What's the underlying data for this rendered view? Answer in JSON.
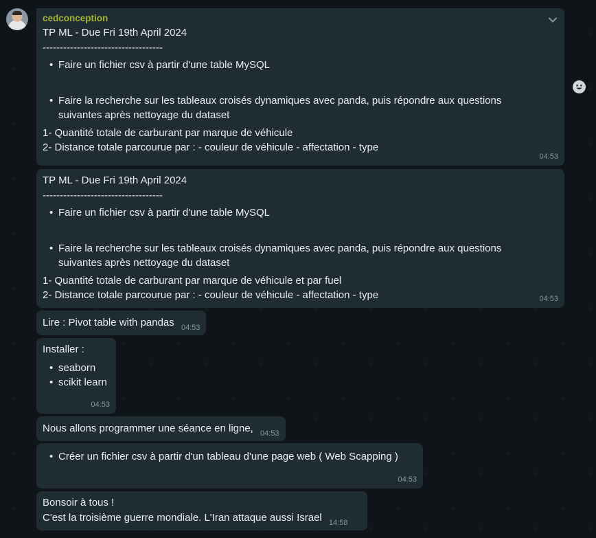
{
  "sender": "cedconception",
  "messages": [
    {
      "title": "TP ML - Due Fri 19th April 2024",
      "divider": "-----------------------------------",
      "bullet1": "Faire un fichier csv à partir d'une table MySQL",
      "bullet2_line1": "Faire la recherche sur les tableaux croisés dynamiques avec panda, puis répondre aux questions",
      "bullet2_line2": "suivantes après nettoyage du dataset",
      "q1": "1- Quantité totale de carburant par marque de véhicule",
      "q2": "2- Distance totale parcourue par : - couleur de véhicule - affectation - type",
      "time": "04:53"
    },
    {
      "title": "TP ML - Due Fri 19th April 2024",
      "divider": "-----------------------------------",
      "bullet1": "Faire un fichier csv à partir d'une table MySQL",
      "bullet2_line1": "Faire la recherche sur les tableaux croisés dynamiques avec panda, puis répondre aux questions",
      "bullet2_line2": "suivantes après nettoyage du dataset",
      "q1": "1- Quantité totale de carburant par marque de véhicule et par fuel",
      "q2": "2- Distance totale parcourue par : - couleur de véhicule - affectation - type",
      "time": "04:53"
    },
    {
      "text": "Lire : Pivot table with pandas",
      "time": "04:53"
    },
    {
      "header": "Installer :",
      "items": [
        "seaborn",
        "scikit learn"
      ],
      "time": "04:53"
    },
    {
      "text": "Nous allons programmer une séance en ligne,",
      "time": "04:53"
    },
    {
      "bullet": "Créer un fichier csv à partir d'un tableau d'une page web ( Web Scapping )",
      "time": "04:53"
    },
    {
      "line1": "Bonsoir à tous !",
      "line2": "C'est la troisième guerre mondiale. L'Iran attaque aussi Israel",
      "time": "14:58"
    }
  ],
  "icons": {
    "avatar": "avatar",
    "menu": "chevron-down-icon",
    "emoji": "emoji-icon"
  }
}
